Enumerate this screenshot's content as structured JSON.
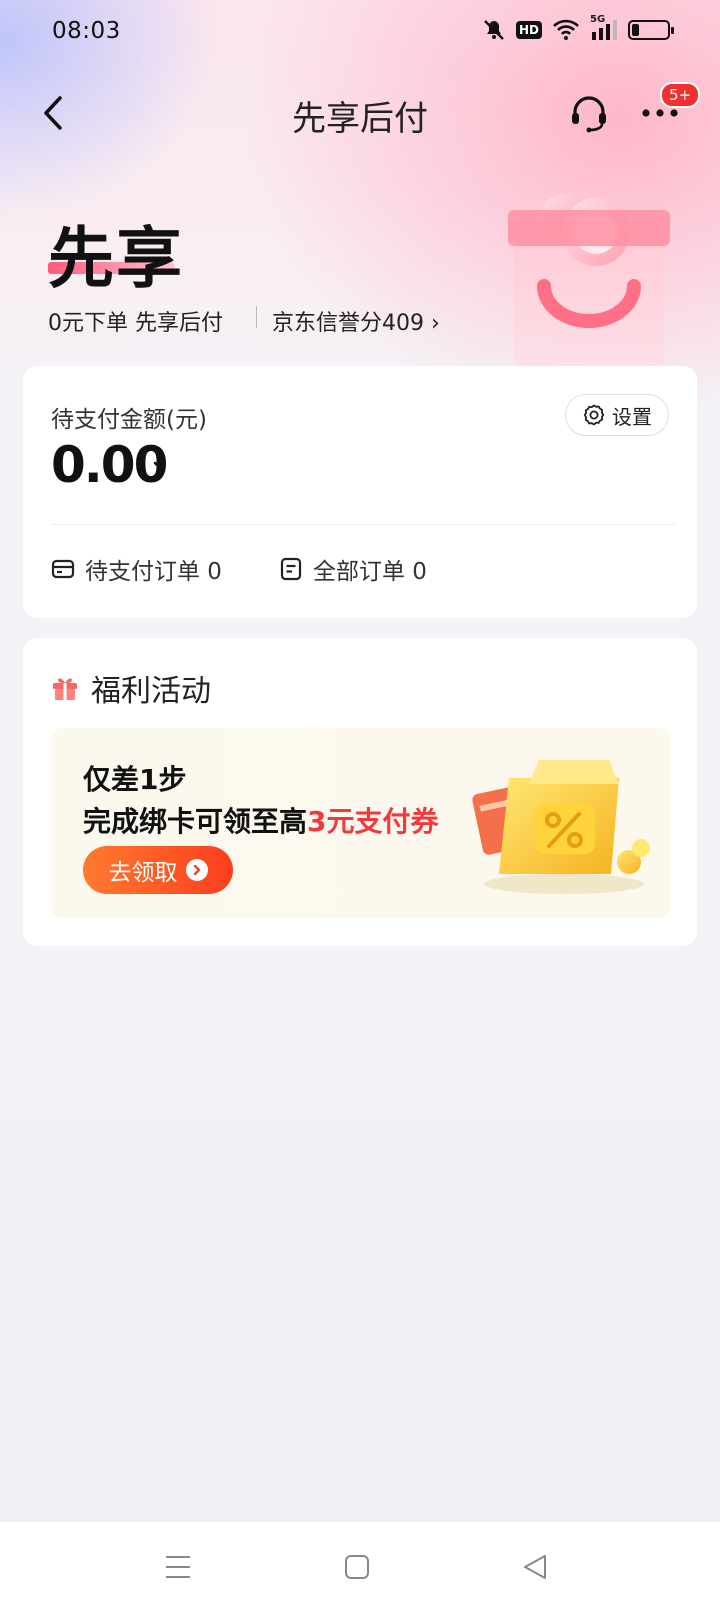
{
  "status_bar": {
    "time": "08:03",
    "network": "5G",
    "hd": "HD"
  },
  "nav": {
    "title": "先享后付",
    "badge": "5+"
  },
  "hero": {
    "title": "先享",
    "subtitle": "0元下单 先享后付",
    "credit_score": "京东信誉分409 ›"
  },
  "payment": {
    "label": "待支付金额(元)",
    "amount": "0.00",
    "settings_label": "设置",
    "pending_orders": "待支付订单 0",
    "all_orders": "全部订单 0"
  },
  "welfare": {
    "title": "福利活动",
    "promo_line1": "仅差1步",
    "promo_line2_prefix": "完成绑卡可领至高",
    "promo_line2_highlight": "3元支付券",
    "claim_label": "去领取"
  },
  "colors": {
    "accent_red": "#f2383f",
    "button_orange": "#fc3e1d",
    "badge_red": "#f23030"
  },
  "icons": [
    "mute-icon",
    "wifi-icon",
    "signal-icon",
    "battery-icon",
    "back-icon",
    "headset-icon",
    "more-icon",
    "gear-icon",
    "card-icon",
    "list-icon",
    "gift-icon",
    "menu-icon",
    "home-icon",
    "back-triangle-icon"
  ]
}
